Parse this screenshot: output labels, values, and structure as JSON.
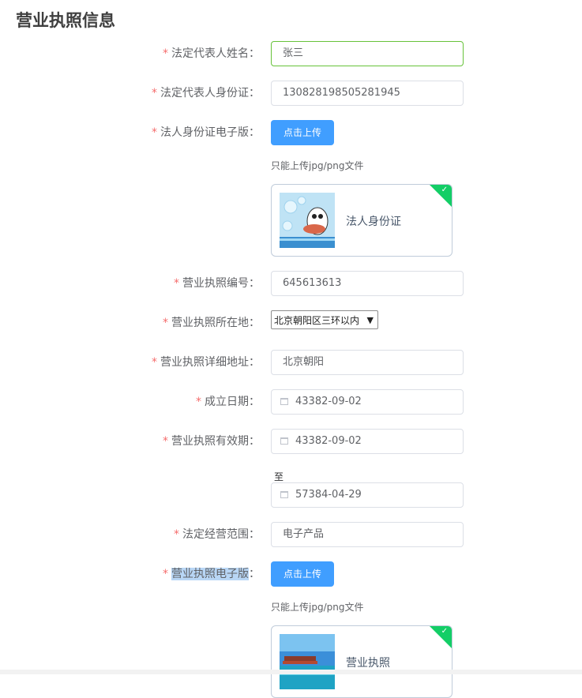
{
  "section_title": "营业执照信息",
  "star": "*",
  "fields": {
    "legal_name": {
      "label": "法定代表人姓名",
      "value": "张三"
    },
    "legal_id": {
      "label": "法定代表人身份证",
      "value": "130828198505281945"
    },
    "legal_id_scan": {
      "label": "法人身份证电子版"
    },
    "license_no": {
      "label": "营业执照编号",
      "value": "645613613"
    },
    "license_location": {
      "label": "营业执照所在地",
      "selected": "北京朝阳区三环以内"
    },
    "license_address": {
      "label": "营业执照详细地址",
      "value": "北京朝阳"
    },
    "founded_date": {
      "label": "成立日期",
      "value": "43382-09-02"
    },
    "validity": {
      "label": "营业执照有效期",
      "start": "43382-09-02",
      "to_text": "至",
      "end": "57384-04-29"
    },
    "scope": {
      "label": "法定经营范围",
      "value": "电子产品"
    },
    "license_scan": {
      "label": "营业执照电子版"
    }
  },
  "label_colon": "：",
  "upload": {
    "button_label": "点击上传",
    "tip": "只能上传jpg/png文件",
    "files": {
      "id_card": {
        "name": "法人身份证"
      },
      "license": {
        "name": "营业执照"
      }
    }
  },
  "colors": {
    "primary": "#409eff",
    "required_star": "#f56c6c",
    "success": "#13ce66",
    "focus_border": "#67c23a",
    "label_highlight": "#b8d6f5"
  }
}
